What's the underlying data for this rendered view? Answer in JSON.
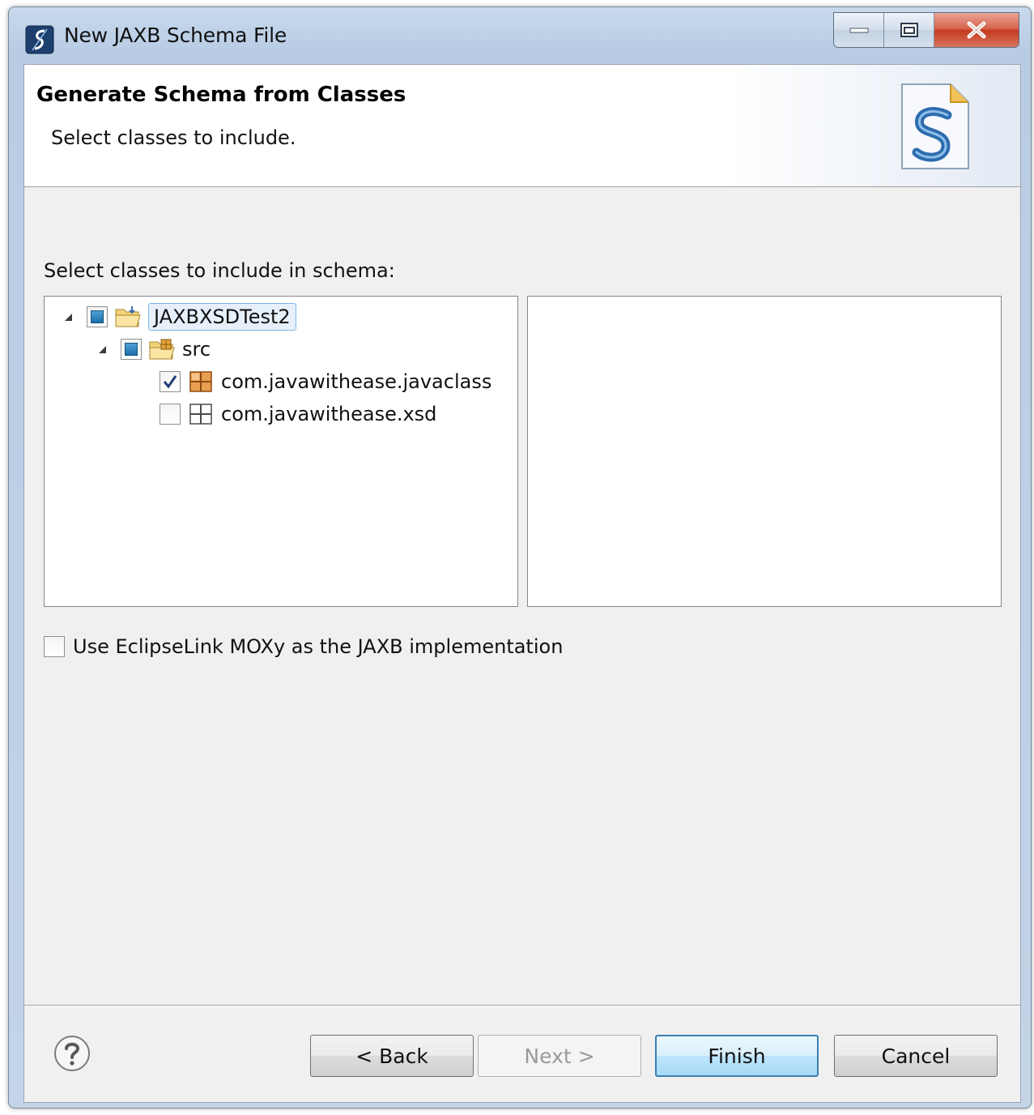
{
  "window": {
    "title": "New JAXB Schema File"
  },
  "header": {
    "title": "Generate Schema from Classes",
    "description": "Select classes to include."
  },
  "content": {
    "group_label": "Select classes to include in schema:",
    "tree": {
      "project": {
        "label": "JAXBXSDTest2",
        "state": "partial",
        "expanded": true,
        "selected": true
      },
      "source_folder": {
        "label": "src",
        "state": "partial",
        "expanded": true
      },
      "packages": [
        {
          "label": "com.javawithease.javaclass",
          "checked": true
        },
        {
          "label": "com.javawithease.xsd",
          "checked": false
        }
      ]
    },
    "moxy": {
      "label": "Use EclipseLink MOXy as the JAXB implementation",
      "checked": false
    }
  },
  "footer": {
    "back_label": "< Back",
    "next_label": "Next >",
    "finish_label": "Finish",
    "cancel_label": "Cancel"
  },
  "icons": {
    "app": "eclipse-schema-icon",
    "help": "help-icon",
    "project": "project-folder-icon",
    "source_folder": "source-folder-icon",
    "package": "package-icon"
  },
  "colors": {
    "accent": "#3c7fb1",
    "selection": "#e6f0fb",
    "close_button": "#c43b20"
  }
}
